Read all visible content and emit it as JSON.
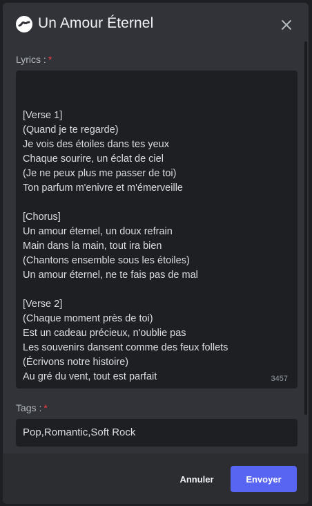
{
  "modal": {
    "title": "Un Amour Éternel",
    "app_icon": "app-logo-icon",
    "close_icon": "close-icon"
  },
  "lyrics_field": {
    "label": "Lyrics :",
    "required_mark": "*",
    "value": "\n[Verse 1]\n(Quand je te regarde)\nJe vois des étoiles dans tes yeux\nChaque sourire, un éclat de ciel\n(Je ne peux plus me passer de toi)\nTon parfum m'enivre et m'émerveille\n\n[Chorus]\nUn amour éternel, un doux refrain\nMain dans la main, tout ira bien\n(Chantons ensemble sous les étoiles)\nUn amour éternel, ne te fais pas de mal\n\n[Verse 2]\n(Chaque moment près de toi)\nEst un cadeau précieux, n'oublie pas\nLes souvenirs dansent comme des feux follets\n(Écrivons notre histoire)\nAu gré du vent, tout est parfait",
    "char_count": "3457"
  },
  "tags_field": {
    "label": "Tags :",
    "required_mark": "*",
    "value": "Pop,Romantic,Soft Rock"
  },
  "footer": {
    "cancel_label": "Annuler",
    "submit_label": "Envoyer"
  },
  "colors": {
    "background": "#313338",
    "input_bg": "#1e1f22",
    "accent": "#5865f2",
    "required": "#f23f43"
  }
}
